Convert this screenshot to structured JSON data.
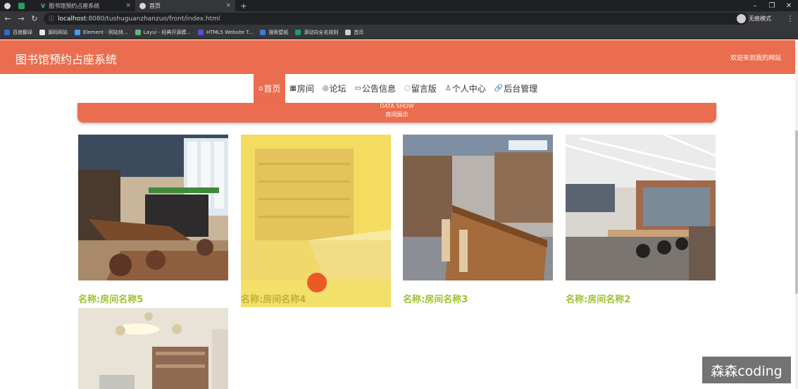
{
  "browser": {
    "tabs": [
      {
        "title": "图书馆预约占座系统",
        "close": "×"
      },
      {
        "title": "首页",
        "close": "×"
      }
    ],
    "new_tab": "+",
    "url_host": "localhost",
    "url_rest": ":8080/tushuguanzhanzuo/front/index.html",
    "profile_label": "无痕模式",
    "bookmarks": [
      {
        "label": "百度翻译",
        "color": "#2b6fd6"
      },
      {
        "label": "源码网站",
        "color": "#e8e8e8"
      },
      {
        "label": "Element - 网站快...",
        "color": "#409eff"
      },
      {
        "label": "Layui - 经典开源模...",
        "color": "#5fb878"
      },
      {
        "label": "HTML5 Website T...",
        "color": "#5a4fcf"
      },
      {
        "label": "搜索壁纸",
        "color": "#3a7bd5"
      },
      {
        "label": "滚动向全名规则",
        "color": "#1aa260"
      },
      {
        "label": "首页",
        "color": "#d0d0d0"
      }
    ]
  },
  "site": {
    "title": "图书馆预约占座系统",
    "welcome": "欢迎来到我的网站",
    "accent": "#eb6d4f",
    "name_color": "#9ec12c"
  },
  "nav": [
    {
      "icon": "⌂",
      "label": "首页",
      "active": true
    },
    {
      "icon": "▦",
      "label": "房间"
    },
    {
      "icon": "◎",
      "label": "论坛"
    },
    {
      "icon": "▭",
      "label": "公告信息"
    },
    {
      "icon": "◌",
      "label": "留言版"
    },
    {
      "icon": "♙",
      "label": "个人中心"
    },
    {
      "icon": "🔗",
      "label": "后台管理"
    }
  ],
  "banner": {
    "en": "DATA SHOW",
    "cn": "房间展示"
  },
  "rooms": [
    {
      "name": "名称:房间名称5"
    },
    {
      "name": "名称:房间名称4"
    },
    {
      "name": "名称:房间名称3"
    },
    {
      "name": "名称:房间名称2"
    },
    {
      "name": ""
    }
  ],
  "watermark": "森森coding"
}
